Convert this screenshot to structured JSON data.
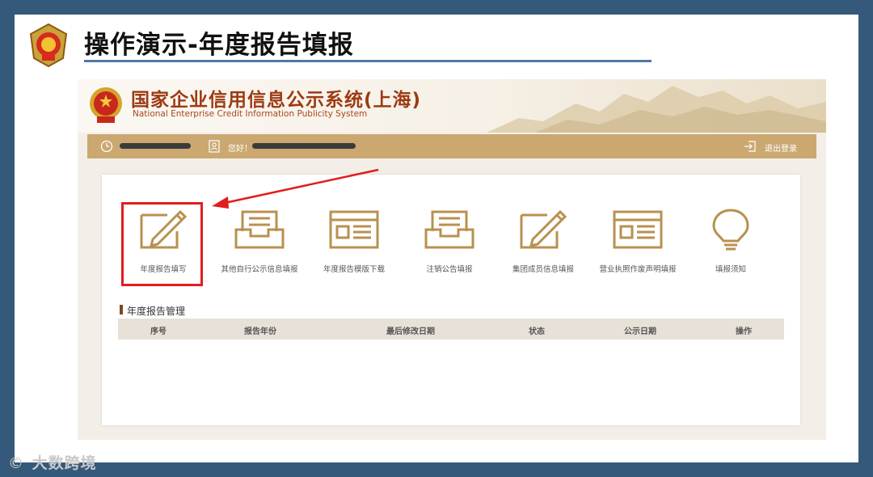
{
  "slide": {
    "title": "操作演示-年度报告填报"
  },
  "site": {
    "title_cn": "国家企业信用信息公示系统(上海)",
    "title_en": "National Enterprise Credit Information Publicity System"
  },
  "topbar": {
    "greeting": "您好！",
    "logout_label": "退出登录"
  },
  "tiles": [
    {
      "label": "年度报告填写",
      "icon": "edit-pencil-icon"
    },
    {
      "label": "其他自行公示信息填报",
      "icon": "inbox-tray-icon"
    },
    {
      "label": "年度报告模版下载",
      "icon": "document-form-icon"
    },
    {
      "label": "注销公告填报",
      "icon": "inbox-tray-icon"
    },
    {
      "label": "集团成员信息填报",
      "icon": "edit-pencil-icon"
    },
    {
      "label": "营业执照作废声明填报",
      "icon": "document-form-icon"
    },
    {
      "label": "填报须知",
      "icon": "lightbulb-icon"
    }
  ],
  "table": {
    "title": "年度报告管理",
    "columns": [
      "序号",
      "报告年份",
      "最后修改日期",
      "状态",
      "公示日期",
      "操作"
    ]
  },
  "watermark": {
    "text": "大数跨境"
  },
  "colors": {
    "accent_gold": "#b8914f",
    "topbar": "#cba870",
    "site_title": "#9c3a12",
    "highlight": "#e11d1d",
    "background": "#35597a"
  }
}
